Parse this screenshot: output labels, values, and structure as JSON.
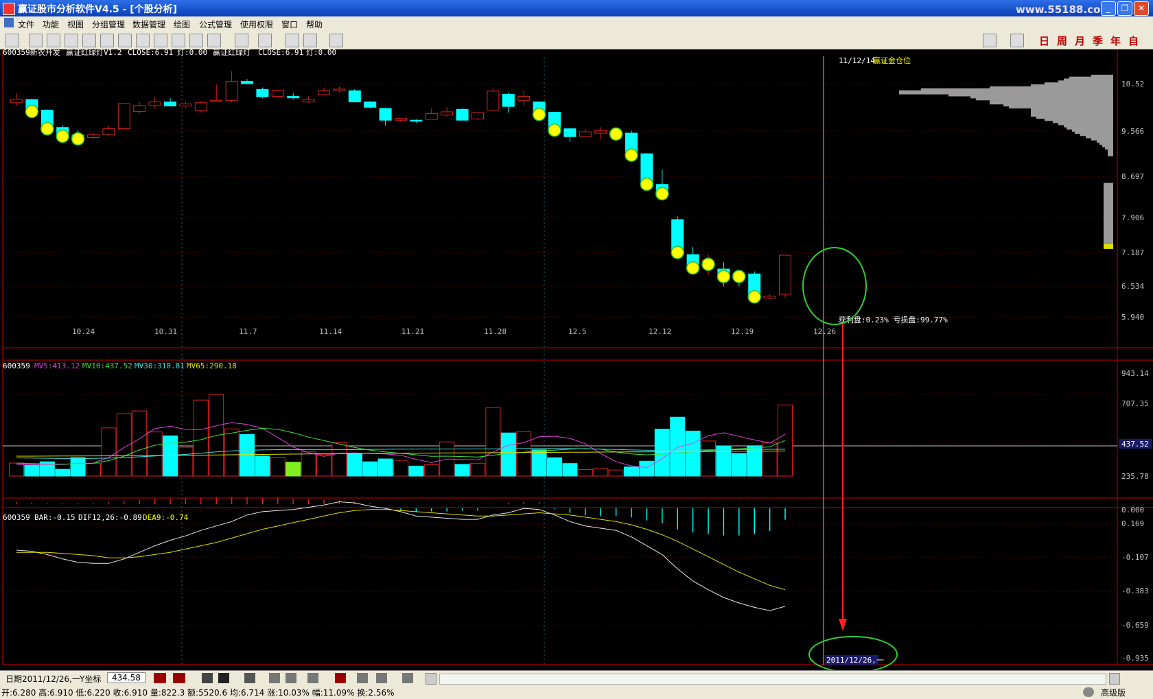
{
  "window": {
    "title": "赢证股市分析软件V4.5 - [个股分析]",
    "watermark": "www.55188.com",
    "minimize": "_",
    "restore": "❐",
    "close": "✕"
  },
  "menu": [
    "文件",
    "功能",
    "视图",
    "分组管理",
    "数据管理",
    "绘图",
    "公式管理",
    "使用权限",
    "窗口",
    "帮助"
  ],
  "period_buttons": [
    "日",
    "周",
    "月",
    "季",
    "年",
    "自"
  ],
  "colors": {
    "up": "#e02020",
    "down": "#00ffff",
    "bg": "#000000",
    "axis": "#c80000",
    "ma5": "#e040e0",
    "ma10": "#40e040",
    "ma30": "#40e0e0",
    "ma65": "#e0e000",
    "marker": "#ffff00"
  },
  "main_panel": {
    "header": {
      "code": "600359新农开发",
      "ind": "赢证红绿灯V1.2",
      "close": "CLOSE:6.91",
      "light": "灯:0.00",
      "ind2": "赢证红绿灯",
      "close2": "CLOSE:6.91",
      "light2": "灯:0.00"
    },
    "chip_title": {
      "date": "11/12/14",
      "label": "赢证金仓位"
    },
    "chip_text": "获利盘:0.23% 亏损盘:99.77%",
    "y_ticks": [
      "10.52",
      "9.566",
      "8.697",
      "7.906",
      "7.187",
      "6.534",
      "5.940"
    ],
    "x_labels": [
      "10.24",
      "10.31",
      "11.7",
      "11.14",
      "11.21",
      "11.28",
      "12.5",
      "12.12",
      "12.19",
      "12.26"
    ]
  },
  "volume_panel": {
    "header": {
      "code": "600359",
      "ma5": "MV5:413.12",
      "ma10": "MV10:437.52",
      "ma30": "MV30:310.81",
      "ma65": "MV65:290.18"
    },
    "y_ticks": [
      "943.14",
      "707.35",
      "235.78",
      "0.000"
    ],
    "highlight": "437.52"
  },
  "macd_panel": {
    "header": {
      "code": "600359",
      "bar": "BAR:-0.15",
      "dif": "DIF12,26:-0.89",
      "dea": "DEA9:-0.74"
    },
    "y_ticks": [
      "0.169",
      "-0.107",
      "-0.383",
      "-0.659",
      "-0.935"
    ],
    "cursor_label": "2011/12/26,一"
  },
  "status": {
    "date": "日期2011/12/26,一",
    "ylabel": "Y坐标",
    "yvalue": "434.58",
    "version": "高级版"
  },
  "info": "开:6.280 高:6.910 低:6.220 收:6.910 量:822.3 额:5520.6 均:6.714 涨:10.03% 幅:11.09% 换:2.56%",
  "chart_data": {
    "type": "candlestick",
    "title": "600359新农开发",
    "candles": [
      [
        10.05,
        10.27,
        9.97,
        10.12
      ],
      [
        10.12,
        10.14,
        9.78,
        9.86
      ],
      [
        9.86,
        9.88,
        9.42,
        9.45
      ],
      [
        9.45,
        9.5,
        9.2,
        9.28
      ],
      [
        9.28,
        9.39,
        9.11,
        9.22
      ],
      [
        9.22,
        9.32,
        9.18,
        9.28
      ],
      [
        9.28,
        9.48,
        9.25,
        9.42
      ],
      [
        9.42,
        10.03,
        9.42,
        10.02
      ],
      [
        9.83,
        10.05,
        9.78,
        9.97
      ],
      [
        9.97,
        10.18,
        9.9,
        10.06
      ],
      [
        10.06,
        10.16,
        9.95,
        9.96
      ],
      [
        9.96,
        10.07,
        9.9,
        10.01
      ],
      [
        9.85,
        10.08,
        9.8,
        10.04
      ],
      [
        10.1,
        10.5,
        10.1,
        10.1
      ],
      [
        10.1,
        10.85,
        10.05,
        10.58
      ],
      [
        10.58,
        10.64,
        10.52,
        10.52
      ],
      [
        10.37,
        10.42,
        10.15,
        10.19
      ],
      [
        10.2,
        10.36,
        10.18,
        10.35
      ],
      [
        10.2,
        10.28,
        10.12,
        10.16
      ],
      [
        10.06,
        10.2,
        10.04,
        10.12
      ],
      [
        10.24,
        10.42,
        10.22,
        10.34
      ],
      [
        10.34,
        10.45,
        10.3,
        10.38
      ],
      [
        10.34,
        10.38,
        10.06,
        10.06
      ],
      [
        10.06,
        10.08,
        9.9,
        9.93
      ],
      [
        9.9,
        9.92,
        9.49,
        9.62
      ],
      [
        9.62,
        9.66,
        9.58,
        9.66
      ],
      [
        9.62,
        9.64,
        9.56,
        9.6
      ],
      [
        9.64,
        9.9,
        9.64,
        9.78
      ],
      [
        9.74,
        9.94,
        9.7,
        9.82
      ],
      [
        9.88,
        9.9,
        9.62,
        9.62
      ],
      [
        9.65,
        9.8,
        9.62,
        9.8
      ],
      [
        9.86,
        10.41,
        9.84,
        10.33
      ],
      [
        10.25,
        10.3,
        9.8,
        9.95
      ],
      [
        10.1,
        10.36,
        9.96,
        10.2
      ],
      [
        10.06,
        10.08,
        9.75,
        9.79
      ],
      [
        9.81,
        9.82,
        9.35,
        9.42
      ],
      [
        9.42,
        9.44,
        9.12,
        9.24
      ],
      [
        9.24,
        9.42,
        9.22,
        9.35
      ],
      [
        9.32,
        9.46,
        9.18,
        9.38
      ],
      [
        9.33,
        9.42,
        9.3,
        9.34
      ],
      [
        9.32,
        9.38,
        8.8,
        8.86
      ],
      [
        8.86,
        8.88,
        8.24,
        8.25
      ],
      [
        8.22,
        8.52,
        7.91,
        8.06
      ],
      [
        7.54,
        7.6,
        6.95,
        6.98
      ],
      [
        6.92,
        7.05,
        6.7,
        6.72
      ],
      [
        6.78,
        6.92,
        6.58,
        6.82
      ],
      [
        6.68,
        6.8,
        6.4,
        6.58
      ],
      [
        6.6,
        6.62,
        6.4,
        6.58
      ],
      [
        6.6,
        6.64,
        6.2,
        6.26
      ],
      [
        6.22,
        6.28,
        6.2,
        6.25
      ],
      [
        6.28,
        6.91,
        6.22,
        6.91
      ]
    ],
    "markers": [
      1,
      2,
      3,
      4,
      34,
      35,
      39,
      40,
      41,
      42,
      43,
      44,
      45,
      46,
      47,
      48
    ],
    "volume": [
      150,
      130,
      165,
      78,
      213,
      145,
      556,
      722,
      752,
      510,
      465,
      333,
      878,
      943,
      545,
      480,
      232,
      218,
      160,
      280,
      248,
      385,
      260,
      165,
      198,
      182,
      115,
      130,
      395,
      135,
      148,
      790,
      498,
      512,
      303,
      212,
      145,
      75,
      88,
      70,
      105,
      172,
      542,
      680,
      520,
      405,
      345,
      262,
      350,
      382,
      822
    ],
    "ma5": [
      135,
      128,
      132,
      135,
      147,
      150,
      215,
      330,
      432,
      547,
      576,
      538,
      536,
      582,
      618,
      596,
      552,
      446,
      335,
      271,
      228,
      265,
      268,
      261,
      255,
      240,
      193,
      157,
      197,
      191,
      187,
      278,
      357,
      386,
      455,
      460,
      435,
      375,
      260,
      165,
      118,
      98,
      202,
      332,
      380,
      466,
      500,
      458,
      418,
      381,
      482
    ],
    "ma10": [
      150,
      145,
      140,
      138,
      142,
      148,
      178,
      230,
      302,
      356,
      380,
      392,
      420,
      470,
      496,
      528,
      552,
      540,
      500,
      450,
      410,
      370,
      330,
      300,
      280,
      262,
      246,
      228,
      230,
      225,
      220,
      241,
      262,
      275,
      294,
      299,
      311,
      316,
      311,
      278,
      255,
      245,
      254,
      268,
      280,
      294,
      306,
      316,
      326,
      338,
      413
    ],
    "ma30": [
      210,
      208,
      205,
      203,
      203,
      204,
      208,
      214,
      222,
      232,
      242,
      250,
      265,
      280,
      290,
      298,
      302,
      305,
      306,
      304,
      304,
      304,
      305,
      308,
      310,
      311,
      312,
      312,
      312,
      313,
      313,
      314,
      316,
      317,
      318,
      318,
      317,
      314,
      311,
      307,
      302,
      298,
      298,
      298,
      300,
      302,
      304,
      306,
      308,
      309,
      310
    ],
    "ma65": [
      230,
      230,
      231,
      232,
      232,
      233,
      234,
      235,
      236,
      237,
      238,
      240,
      242,
      244,
      246,
      248,
      250,
      252,
      254,
      256,
      258,
      260,
      261,
      262,
      263,
      264,
      265,
      266,
      267,
      268,
      269,
      270,
      271,
      272,
      273,
      274,
      275,
      276,
      277,
      278,
      279,
      280,
      281,
      282,
      283,
      284,
      285,
      286,
      287,
      288,
      290
    ],
    "dif": [
      -0.38,
      -0.39,
      -0.42,
      -0.46,
      -0.49,
      -0.5,
      -0.5,
      -0.46,
      -0.4,
      -0.34,
      -0.29,
      -0.25,
      -0.2,
      -0.16,
      -0.12,
      -0.06,
      -0.03,
      -0.02,
      -0.01,
      0.01,
      0.03,
      0.06,
      0.05,
      0.02,
      0.0,
      -0.03,
      -0.07,
      -0.08,
      -0.09,
      -0.1,
      -0.1,
      -0.06,
      -0.04,
      0.0,
      -0.01,
      -0.06,
      -0.12,
      -0.16,
      -0.18,
      -0.2,
      -0.26,
      -0.34,
      -0.42,
      -0.55,
      -0.66,
      -0.74,
      -0.81,
      -0.86,
      -0.9,
      -0.93,
      -0.89
    ],
    "dea": [
      -0.4,
      -0.4,
      -0.4,
      -0.41,
      -0.42,
      -0.43,
      -0.45,
      -0.45,
      -0.44,
      -0.42,
      -0.4,
      -0.37,
      -0.34,
      -0.31,
      -0.27,
      -0.23,
      -0.19,
      -0.16,
      -0.13,
      -0.1,
      -0.07,
      -0.04,
      -0.02,
      -0.01,
      -0.01,
      -0.02,
      -0.03,
      -0.04,
      -0.05,
      -0.06,
      -0.07,
      -0.07,
      -0.06,
      -0.05,
      -0.04,
      -0.05,
      -0.06,
      -0.08,
      -0.1,
      -0.12,
      -0.15,
      -0.19,
      -0.24,
      -0.3,
      -0.37,
      -0.44,
      -0.51,
      -0.58,
      -0.64,
      -0.7,
      -0.74
    ],
    "macd_bar": [
      0.04,
      0.03,
      0.02,
      0.02,
      0.02,
      0.02,
      0.04,
      0.06,
      0.08,
      0.1,
      0.1,
      0.11,
      0.12,
      0.13,
      0.13,
      0.13,
      0.12,
      0.11,
      0.1,
      0.09,
      0.08,
      0.07,
      0.05,
      0.02,
      -0.01,
      -0.03,
      -0.05,
      -0.04,
      -0.04,
      -0.03,
      -0.03,
      0.01,
      0.03,
      0.05,
      0.04,
      -0.01,
      -0.06,
      -0.09,
      -0.1,
      -0.1,
      -0.12,
      -0.16,
      -0.2,
      -0.28,
      -0.32,
      -0.34,
      -0.36,
      -0.36,
      -0.34,
      -0.3,
      -0.15
    ],
    "chip_profile": [
      [
        10.7,
        0.08
      ],
      [
        10.65,
        0.16
      ],
      [
        10.6,
        0.18
      ],
      [
        10.55,
        0.2
      ],
      [
        10.5,
        0.25
      ],
      [
        10.45,
        0.3
      ],
      [
        10.4,
        0.45
      ],
      [
        10.35,
        0.7
      ],
      [
        10.3,
        0.78
      ],
      [
        10.25,
        0.6
      ],
      [
        10.2,
        0.52
      ],
      [
        10.15,
        0.5
      ],
      [
        10.1,
        0.42
      ],
      [
        10.05,
        0.45
      ],
      [
        10.0,
        0.4
      ],
      [
        9.95,
        0.38
      ],
      [
        9.9,
        0.3
      ],
      [
        9.85,
        0.3
      ],
      [
        9.8,
        0.3
      ],
      [
        9.75,
        0.3
      ],
      [
        9.7,
        0.28
      ],
      [
        9.65,
        0.25
      ],
      [
        9.6,
        0.22
      ],
      [
        9.55,
        0.2
      ],
      [
        9.5,
        0.18
      ],
      [
        9.45,
        0.17
      ],
      [
        9.4,
        0.15
      ],
      [
        9.35,
        0.14
      ],
      [
        9.3,
        0.12
      ],
      [
        9.25,
        0.1
      ],
      [
        9.2,
        0.08
      ],
      [
        9.15,
        0.06
      ],
      [
        9.1,
        0.05
      ],
      [
        9.05,
        0.04
      ],
      [
        9.0,
        0.03
      ],
      [
        8.95,
        0.02
      ],
      [
        8.9,
        0.02
      ],
      [
        8.85,
        0.02
      ]
    ]
  }
}
